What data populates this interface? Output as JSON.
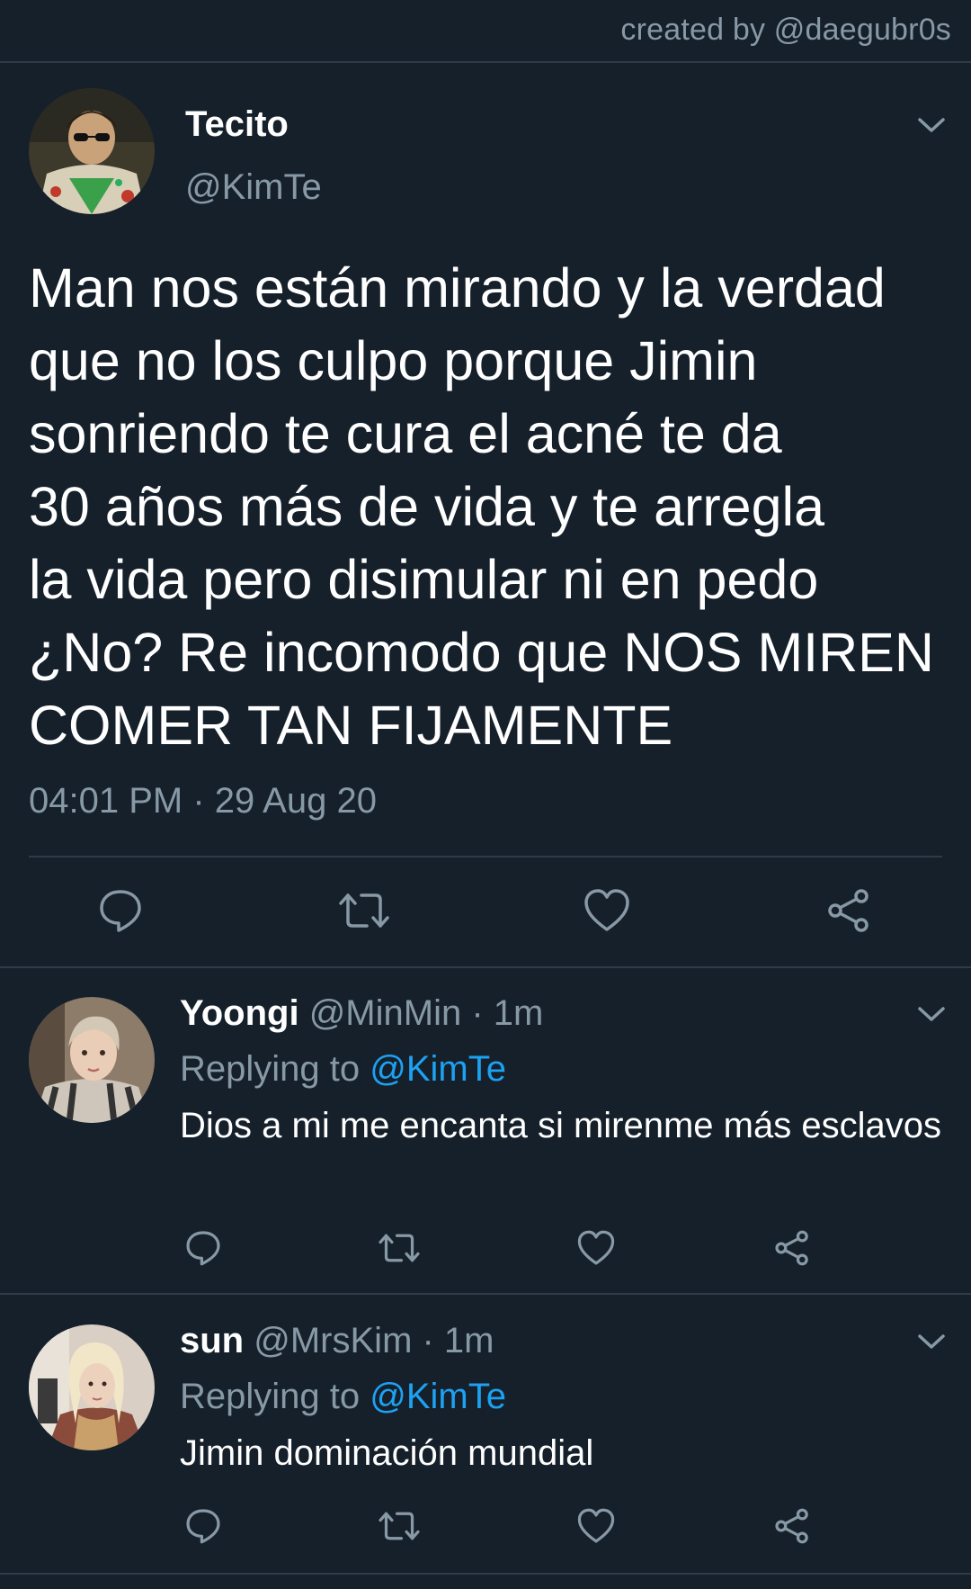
{
  "credit": "created by @daegubr0s",
  "main_tweet": {
    "name": "Tecito",
    "handle": "@KimTe",
    "text": "Man nos están mirando y la verdad\nque no los culpo porque Jimin\nsonriendo te cura el acné te da\n30 años más de vida y te arregla\nla vida pero disimular ni en pedo\n¿No? Re incomodo que NOS MIREN\nCOMER TAN FIJAMENTE",
    "timestamp": "04:01 PM · 29 Aug 20",
    "actions": [
      "reply-icon",
      "retweet-icon",
      "like-icon",
      "share-icon"
    ]
  },
  "replies": [
    {
      "name": "Yoongi",
      "handle_time": "@MinMin · 1m",
      "replying_prefix": "Replying to",
      "replying_to": "@KimTe",
      "text": "Dios a mi me encanta si mirenme más esclavos"
    },
    {
      "name": "sun",
      "handle_time": "@MrsKim · 1m",
      "replying_prefix": "Replying to",
      "replying_to": "@KimTe",
      "text": "Jimin dominación mundial"
    }
  ],
  "colors": {
    "background": "#15202b",
    "secondary_text": "#8899a6",
    "link": "#1da1f2",
    "divider": "#2f3b47"
  }
}
